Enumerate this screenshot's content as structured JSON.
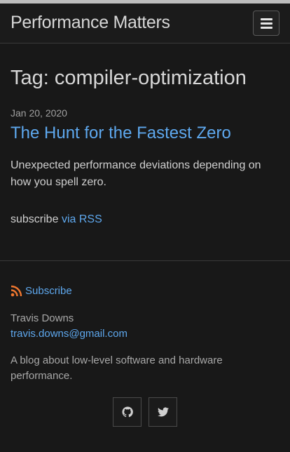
{
  "header": {
    "site_title": "Performance Matters",
    "menu_icon": "hamburger-icon"
  },
  "main": {
    "heading": "Tag: compiler-optimization",
    "posts": [
      {
        "date": "Jan 20, 2020",
        "title": "The Hunt for the Fastest Zero",
        "excerpt": "Unexpected performance deviations depending on how you spell zero."
      }
    ],
    "subscribe_prefix": "subscribe",
    "subscribe_link": "via RSS"
  },
  "footer": {
    "subscribe_label": "Subscribe",
    "subscribe_icon": "rss-icon",
    "author_name": "Travis Downs",
    "author_email": "travis.downs@gmail.com",
    "description": "A blog about low-level software and hardware performance.",
    "social": [
      {
        "icon": "github-icon"
      },
      {
        "icon": "twitter-icon"
      }
    ]
  },
  "colors": {
    "background": "#181818",
    "link": "#5ea8ee",
    "rss": "#f0772f"
  }
}
